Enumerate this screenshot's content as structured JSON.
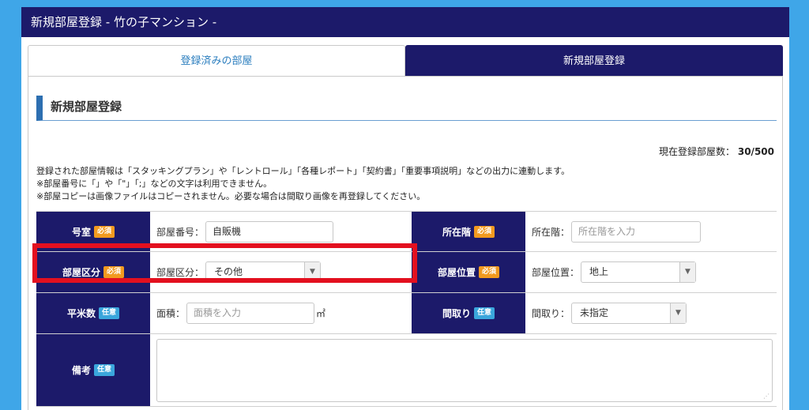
{
  "window": {
    "title": "新規部屋登録 - 竹の子マンション -"
  },
  "tabs": [
    {
      "label": "登録済みの部屋"
    },
    {
      "label": "新規部屋登録"
    }
  ],
  "section": {
    "heading": "新規部屋登録"
  },
  "count": {
    "label": "現在登録部屋数：",
    "value": "30/500"
  },
  "notes": [
    "登録された部屋情報は「スタッキングプラン」や「レントロール」「各種レポート」「契約書」「重要事項説明」などの出力に連動します。",
    "※部屋番号に「」や「\"」「;」などの文字は利用できません。",
    "※部屋コピーは画像ファイルはコピーされません。必要な場合は間取り画像を再登録してください。"
  ],
  "badges": {
    "required": "必須",
    "optional": "任意"
  },
  "form": {
    "room_no": {
      "label": "号室",
      "field_label": "部屋番号：",
      "value": "自販機"
    },
    "floor": {
      "label": "所在階",
      "field_label": "所在階：",
      "placeholder": "所在階を入力"
    },
    "category": {
      "label": "部屋区分",
      "field_label": "部屋区分：",
      "selected": "その他"
    },
    "position": {
      "label": "部屋位置",
      "field_label": "部屋位置：",
      "selected": "地上"
    },
    "area": {
      "label": "平米数",
      "field_label": "面積：",
      "placeholder": "面積を入力",
      "unit": "㎡"
    },
    "layout": {
      "label": "間取り",
      "field_label": "間取り：",
      "selected": "未指定"
    },
    "remarks": {
      "label": "備考"
    }
  },
  "colors": {
    "navy": "#1c1a6a",
    "accent_blue": "#2d6fb1",
    "required_badge": "#f29a1f",
    "optional_badge": "#3aa6dc",
    "highlight": "#e3101f",
    "background": "#3fa6e8"
  }
}
